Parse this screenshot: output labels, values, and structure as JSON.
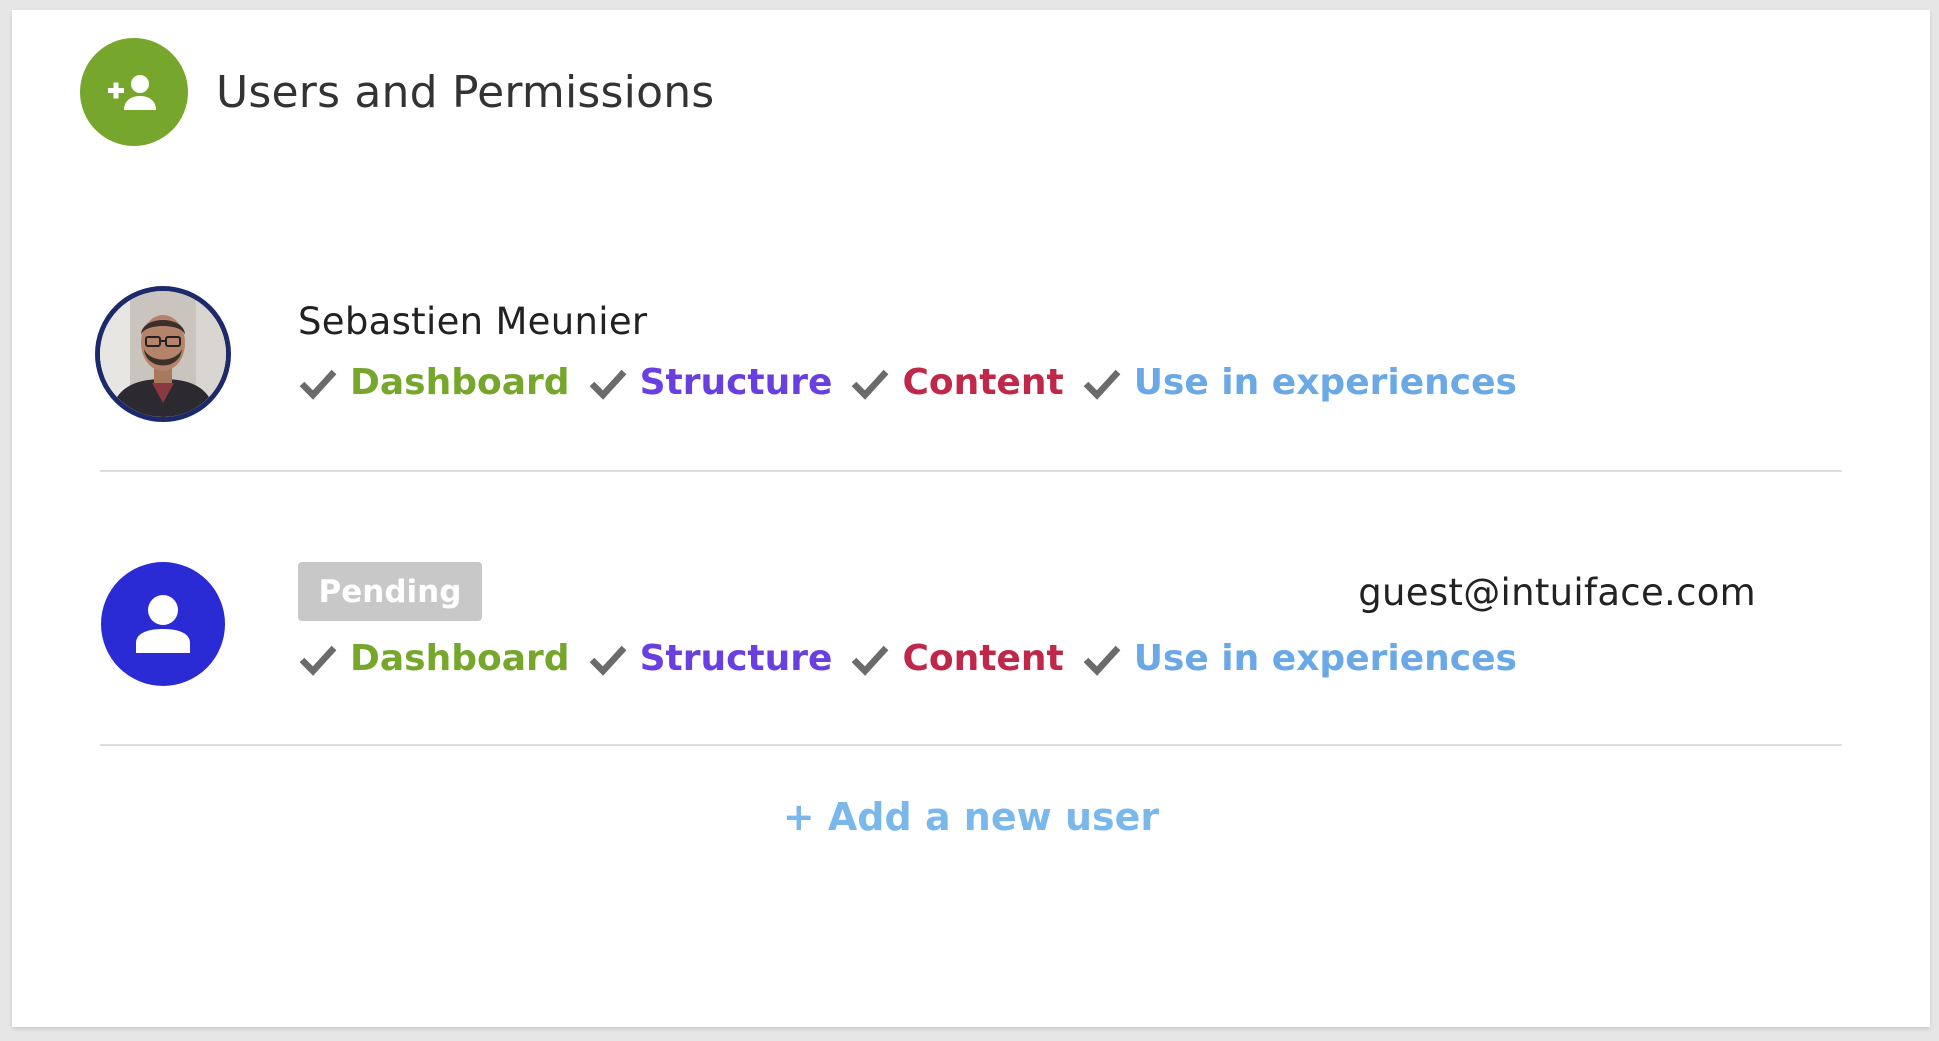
{
  "header": {
    "title": "Users and Permissions",
    "icon": "add-user-icon",
    "icon_color": "#76a72c"
  },
  "permission_colors": {
    "dashboard": "#76a72c",
    "structure": "#6a3fe0",
    "content": "#c0284a",
    "use_in_experiences": "#6aa8e6",
    "check": "#6b6b6b"
  },
  "users": [
    {
      "name": "Sebastien Meunier",
      "avatar": "profile-photo",
      "permissions": {
        "dashboard": "Dashboard",
        "structure": "Structure",
        "content": "Content",
        "use_in_experiences": "Use in experiences"
      }
    },
    {
      "status": "Pending",
      "email": "guest@intuiface.com",
      "avatar": "default-user-icon",
      "avatar_color": "#2b2bd6",
      "permissions": {
        "dashboard": "Dashboard",
        "structure": "Structure",
        "content": "Content",
        "use_in_experiences": "Use in experiences"
      }
    }
  ],
  "add_user": {
    "label": "+ Add a new user",
    "color": "#7ab8ec"
  }
}
